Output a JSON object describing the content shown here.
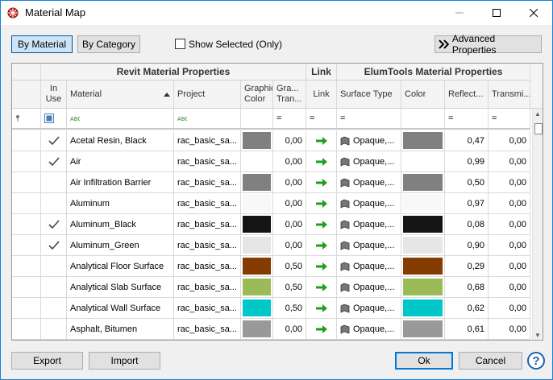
{
  "window": {
    "title": "Material Map"
  },
  "toolbar": {
    "by_material": "By Material",
    "by_category": "By Category",
    "show_selected": "Show Selected (Only)",
    "advanced": "Advanced Properties"
  },
  "headers": {
    "group_revit": "Revit Material Properties",
    "group_link": "Link",
    "group_elum": "ElumTools Material Properties",
    "in_use": "In Use",
    "material": "Material",
    "project": "Project",
    "graphic_color": "Graphic Color",
    "graphic_transparency": "Gra... Tran...",
    "link": "Link",
    "surface_type": "Surface Type",
    "color": "Color",
    "reflectance": "Reflect...",
    "transmittance": "Transmi..."
  },
  "filter": {
    "eq": "="
  },
  "rows": [
    {
      "in_use": true,
      "material": "Acetal Resin, Black",
      "project": "rac_basic_sa...",
      "graphic_color": "#808080",
      "transparency": "0,00",
      "surface_type": "Opaque,...",
      "color": "#808080",
      "reflectance": "0,47",
      "transmittance": "0,00"
    },
    {
      "in_use": true,
      "material": "Air",
      "project": "rac_basic_sa...",
      "graphic_color": "#ffffff",
      "transparency": "0,00",
      "surface_type": "Opaque,...",
      "color": "#ffffff",
      "reflectance": "0,99",
      "transmittance": "0,00"
    },
    {
      "in_use": false,
      "material": "Air Infiltration Barrier",
      "project": "rac_basic_sa...",
      "graphic_color": "#808080",
      "transparency": "0,00",
      "surface_type": "Opaque,...",
      "color": "#808080",
      "reflectance": "0,50",
      "transmittance": "0,00"
    },
    {
      "in_use": false,
      "material": "Aluminum",
      "project": "rac_basic_sa...",
      "graphic_color": "#f8f8f8",
      "transparency": "0,00",
      "surface_type": "Opaque,...",
      "color": "#f8f8f8",
      "reflectance": "0,97",
      "transmittance": "0,00"
    },
    {
      "in_use": true,
      "material": "Aluminum_Black",
      "project": "rac_basic_sa...",
      "graphic_color": "#141414",
      "transparency": "0,00",
      "surface_type": "Opaque,...",
      "color": "#141414",
      "reflectance": "0,08",
      "transmittance": "0,00"
    },
    {
      "in_use": true,
      "material": "Aluminum_Green",
      "project": "rac_basic_sa...",
      "graphic_color": "#e6e6e6",
      "transparency": "0,00",
      "surface_type": "Opaque,...",
      "color": "#e6e6e6",
      "reflectance": "0,90",
      "transmittance": "0,00"
    },
    {
      "in_use": false,
      "material": "Analytical Floor Surface",
      "project": "rac_basic_sa...",
      "graphic_color": "#843c00",
      "transparency": "0,50",
      "surface_type": "Opaque,...",
      "color": "#843c00",
      "reflectance": "0,29",
      "transmittance": "0,00"
    },
    {
      "in_use": false,
      "material": "Analytical Slab Surface",
      "project": "rac_basic_sa...",
      "graphic_color": "#9bbb59",
      "transparency": "0,50",
      "surface_type": "Opaque,...",
      "color": "#9bbb59",
      "reflectance": "0,68",
      "transmittance": "0,00"
    },
    {
      "in_use": false,
      "material": "Analytical Wall Surface",
      "project": "rac_basic_sa...",
      "graphic_color": "#00c8c8",
      "transparency": "0,50",
      "surface_type": "Opaque,...",
      "color": "#00c8c8",
      "reflectance": "0,62",
      "transmittance": "0,00"
    },
    {
      "in_use": false,
      "material": "Asphalt, Bitumen",
      "project": "rac_basic_sa...",
      "graphic_color": "#999999",
      "transparency": "0,00",
      "surface_type": "Opaque,...",
      "color": "#999999",
      "reflectance": "0,61",
      "transmittance": "0,00"
    }
  ],
  "footer": {
    "export": "Export",
    "import": "Import",
    "ok": "Ok",
    "cancel": "Cancel",
    "help": "?"
  },
  "colors": {
    "accent": "#0078d7",
    "link_arrow": "#1ea01e"
  }
}
